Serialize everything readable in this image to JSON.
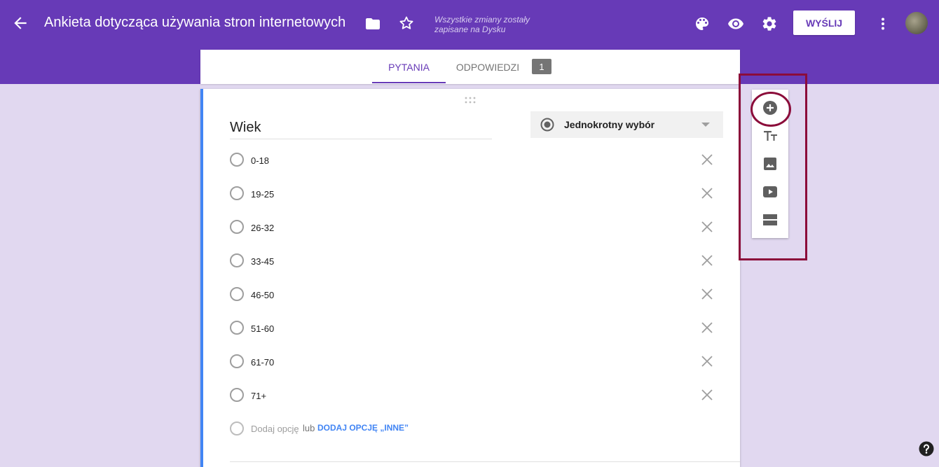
{
  "app": {
    "title": "Ankieta dotycząca używania stron internetowych",
    "save_status": "Wszystkie zmiany zostały zapisane na Dysku",
    "send_label": "WYŚLIJ",
    "accent_color": "#673ab7",
    "background_color": "#e1d8f0"
  },
  "header_icons": {
    "back": "arrow-back-icon",
    "folder": "folder-icon",
    "star": "star-icon",
    "palette": "palette-icon",
    "preview": "eye-icon",
    "settings": "gear-icon",
    "more": "more-vert-icon"
  },
  "tabs": {
    "questions": "PYTANIA",
    "responses": "ODPOWIEDZI",
    "responses_count": "1"
  },
  "question": {
    "title": "Wiek",
    "type": "Jednokrotny wybór",
    "options": [
      "0-18",
      "19-25",
      "26-32",
      "33-45",
      "46-50",
      "51-60",
      "61-70",
      "71+"
    ],
    "add_option_placeholder": "Dodaj opcję",
    "or_text": "lub",
    "add_other_label": "DODAJ OPCJĘ „INNE”"
  },
  "side_toolbar": {
    "items": [
      "add-question-icon",
      "add-title-icon",
      "add-image-icon",
      "add-video-icon",
      "add-section-icon"
    ],
    "highlight_color": "#8b0c3a"
  }
}
